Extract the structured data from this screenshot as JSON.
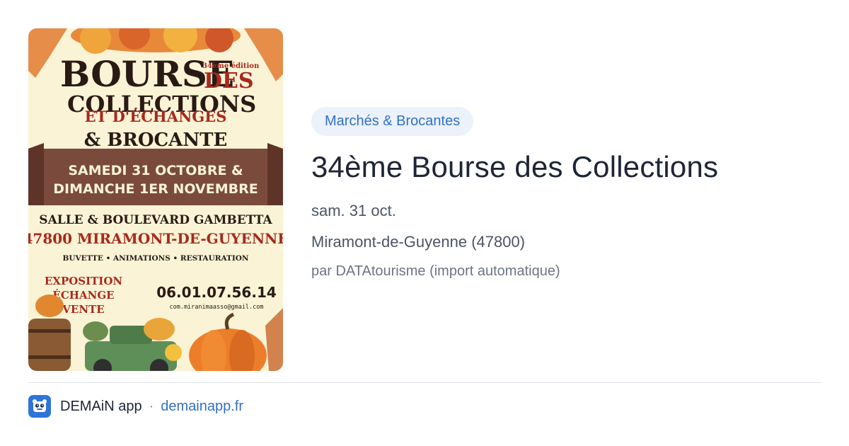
{
  "event": {
    "category": "Marchés & Brocantes",
    "title": "34ème Bourse des Collections",
    "date": "sam. 31 oct.",
    "location": "Miramont-de-Guyenne (47800)",
    "author": "par DATAtourisme (import automatique)"
  },
  "poster": {
    "edition": "34ème édition",
    "line1": "BOURSE",
    "line1b": "DES",
    "line2": "COLLECTIONS",
    "line3": "ET D'ÉCHANGES",
    "line4": "& BROCANTE",
    "banner1": "SAMEDI 31 OCTOBRE &",
    "banner2": "DIMANCHE 1ER NOVEMBRE",
    "venue": "SALLE & BOULEVARD GAMBETTA",
    "city": "47800 MIRAMONT-DE-GUYENNE",
    "services": "BUVETTE • ANIMATIONS • RESTAURATION",
    "expo1": "EXPOSITION",
    "expo2": "ÉCHANGE",
    "expo3": "VENTE",
    "phone": "06.01.07.56.14",
    "email": "com.miranimaasso@gmail.com"
  },
  "footer": {
    "app_name": "DEMAiN app",
    "separator": "·",
    "domain": "demainapp.fr"
  },
  "colors": {
    "accent": "#3370c4",
    "category_bg": "#ebf2fc",
    "title": "#1e2535",
    "poster_red": "#a8291c",
    "poster_banner": "#7a4a3d"
  }
}
